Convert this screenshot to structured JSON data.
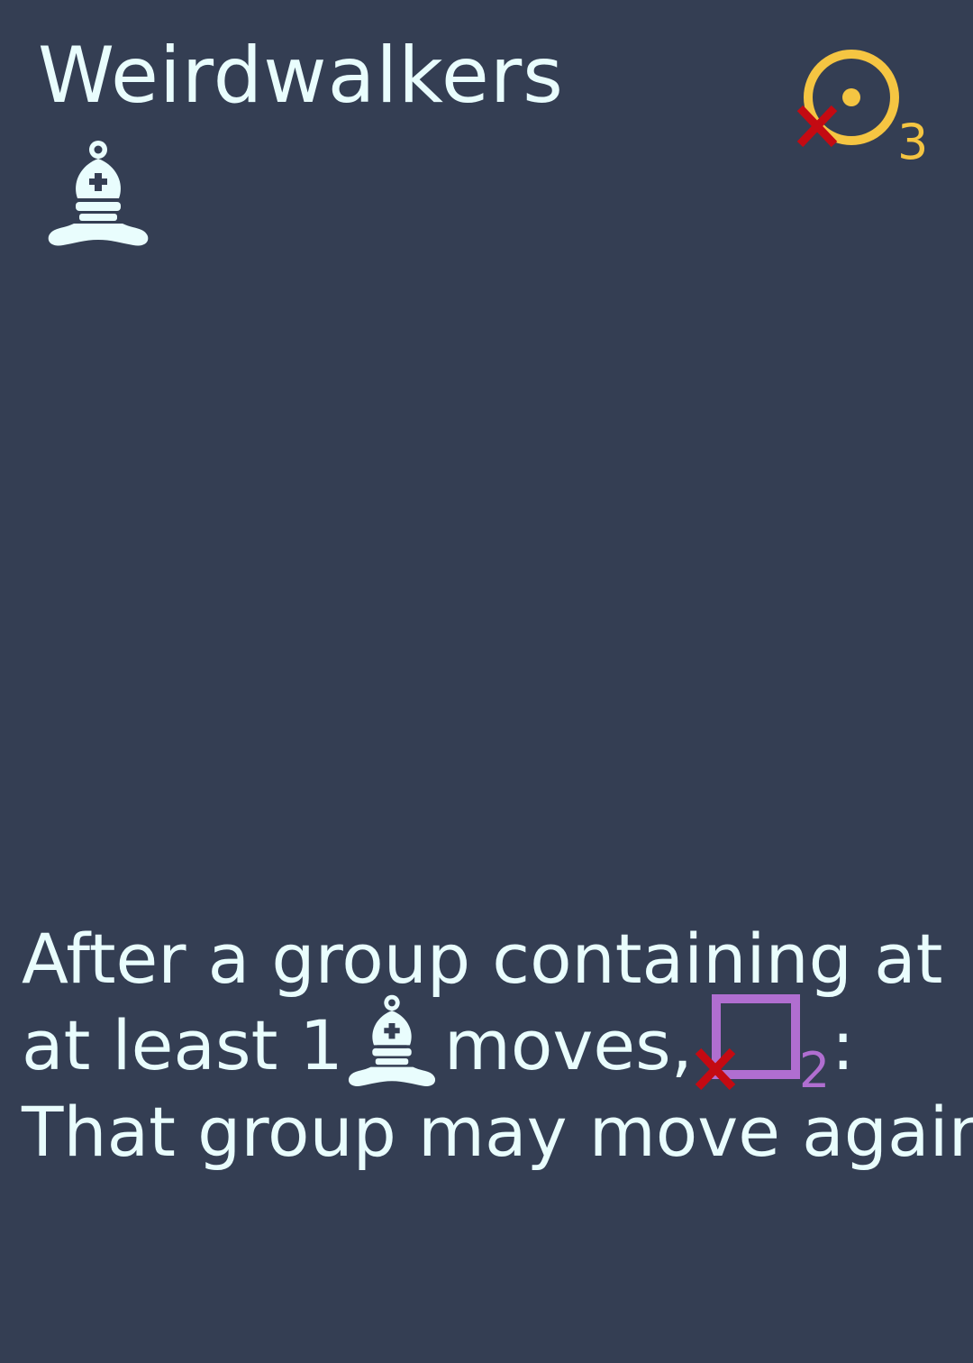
{
  "card": {
    "title": "Weirdwalkers",
    "type_icon": "chess-bishop-icon",
    "cost": {
      "icon": "sun-circle-icon",
      "modifier_icon": "red-x-icon",
      "amount": "3"
    },
    "rules": {
      "line1": "After a group containing at",
      "line2_a": "at least 1",
      "line2_icon": "chess-bishop-icon",
      "line2_b": "moves,",
      "line2_cost_icon": "square-icon",
      "line2_cost_modifier": "red-x-icon",
      "line2_cost_amount": "2",
      "line2_c": ":",
      "line3": "That group may move again."
    }
  },
  "colors": {
    "background": "#343e53",
    "text": "#e9fdfd",
    "sun": "#f5c542",
    "square": "#b06ed0",
    "cross": "#c40a12"
  }
}
